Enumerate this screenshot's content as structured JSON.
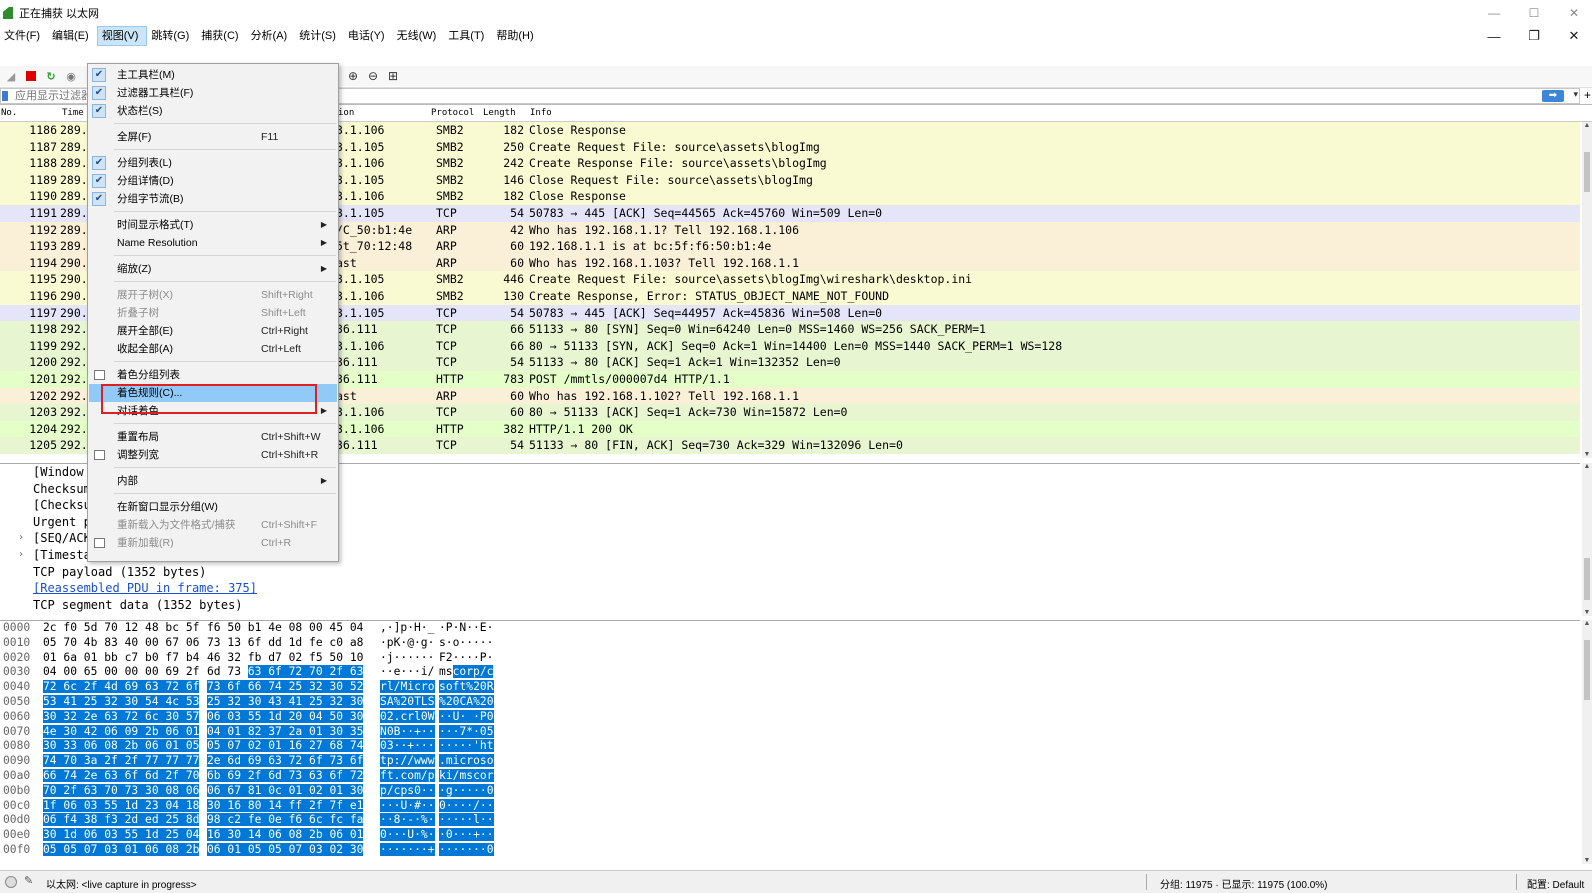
{
  "window": {
    "title": "正在捕获 以太网"
  },
  "menubar": [
    "文件(F)",
    "编辑(E)",
    "视图(V)",
    "跳转(G)",
    "捕获(C)",
    "分析(A)",
    "统计(S)",
    "电话(Y)",
    "无线(W)",
    "工具(T)",
    "帮助(H)"
  ],
  "filter": {
    "placeholder": "应用显示过滤器…"
  },
  "columns": {
    "no": "No.",
    "time": "Time",
    "dest": "ion",
    "protocol": "Protocol",
    "length": "Length",
    "info": "Info"
  },
  "colors": {
    "smb2": "#fafad2",
    "tcp_ack": "#e5e5f9",
    "arp": "#faf0d7",
    "tcp": "#e7f6d1",
    "http": "#e4ffc7",
    "selection": "#0078d7"
  },
  "packets": [
    {
      "no": "1186",
      "time": "289.",
      "dest": "3.1.106",
      "proto": "SMB2",
      "len": "182",
      "info": "Close Response",
      "color": "smb2"
    },
    {
      "no": "1187",
      "time": "289.",
      "dest": "3.1.105",
      "proto": "SMB2",
      "len": "250",
      "info": "Create Request File: source\\assets\\blogImg",
      "color": "smb2"
    },
    {
      "no": "1188",
      "time": "289.",
      "dest": "3.1.106",
      "proto": "SMB2",
      "len": "242",
      "info": "Create Response File: source\\assets\\blogImg",
      "color": "smb2"
    },
    {
      "no": "1189",
      "time": "289.",
      "dest": "3.1.105",
      "proto": "SMB2",
      "len": "146",
      "info": "Close Request File: source\\assets\\blogImg",
      "color": "smb2"
    },
    {
      "no": "1190",
      "time": "289.",
      "dest": "3.1.106",
      "proto": "SMB2",
      "len": "182",
      "info": "Close Response",
      "color": "smb2"
    },
    {
      "no": "1191",
      "time": "289.",
      "dest": "3.1.105",
      "proto": "TCP",
      "len": "54",
      "info": "50783 → 445 [ACK] Seq=44565 Ack=45760 Win=509 Len=0",
      "color": "tcp_ack"
    },
    {
      "no": "1192",
      "time": "289.",
      "dest": "/C_50:b1:4e",
      "proto": "ARP",
      "len": "42",
      "info": "Who has 192.168.1.1? Tell 192.168.1.106",
      "color": "arp"
    },
    {
      "no": "1193",
      "time": "289.",
      "dest": "5t_70:12:48",
      "proto": "ARP",
      "len": "60",
      "info": "192.168.1.1 is at bc:5f:f6:50:b1:4e",
      "color": "arp"
    },
    {
      "no": "1194",
      "time": "290.",
      "dest": "ast",
      "proto": "ARP",
      "len": "60",
      "info": "Who has 192.168.1.103? Tell 192.168.1.1",
      "color": "arp"
    },
    {
      "no": "1195",
      "time": "290.",
      "dest": "3.1.105",
      "proto": "SMB2",
      "len": "446",
      "info": "Create Request File: source\\assets\\blogImg\\wireshark\\desktop.ini",
      "color": "smb2"
    },
    {
      "no": "1196",
      "time": "290.",
      "dest": "3.1.106",
      "proto": "SMB2",
      "len": "130",
      "info": "Create Response, Error: STATUS_OBJECT_NAME_NOT_FOUND",
      "color": "smb2"
    },
    {
      "no": "1197",
      "time": "290.",
      "dest": "3.1.105",
      "proto": "TCP",
      "len": "54",
      "info": "50783 → 445 [ACK] Seq=44957 Ack=45836 Win=508 Len=0",
      "color": "tcp_ack"
    },
    {
      "no": "1198",
      "time": "292.",
      "dest": "36.111",
      "proto": "TCP",
      "len": "66",
      "info": "51133 → 80 [SYN] Seq=0 Win=64240 Len=0 MSS=1460 WS=256 SACK_PERM=1",
      "color": "tcp"
    },
    {
      "no": "1199",
      "time": "292.",
      "dest": "3.1.106",
      "proto": "TCP",
      "len": "66",
      "info": "80 → 51133 [SYN, ACK] Seq=0 Ack=1 Win=14400 Len=0 MSS=1440 SACK_PERM=1 WS=128",
      "color": "tcp"
    },
    {
      "no": "1200",
      "time": "292.",
      "dest": "36.111",
      "proto": "TCP",
      "len": "54",
      "info": "51133 → 80 [ACK] Seq=1 Ack=1 Win=132352 Len=0",
      "color": "tcp"
    },
    {
      "no": "1201",
      "time": "292.",
      "dest": "36.111",
      "proto": "HTTP",
      "len": "783",
      "info": "POST /mmtls/000007d4 HTTP/1.1",
      "color": "http"
    },
    {
      "no": "1202",
      "time": "292.",
      "dest": "ast",
      "proto": "ARP",
      "len": "60",
      "info": "Who has 192.168.1.102? Tell 192.168.1.1",
      "color": "arp"
    },
    {
      "no": "1203",
      "time": "292.",
      "dest": "3.1.106",
      "proto": "TCP",
      "len": "60",
      "info": "80 → 51133 [ACK] Seq=1 Ack=730 Win=15872 Len=0",
      "color": "tcp"
    },
    {
      "no": "1204",
      "time": "292.",
      "dest": "3.1.106",
      "proto": "HTTP",
      "len": "382",
      "info": "HTTP/1.1 200 OK",
      "color": "http"
    },
    {
      "no": "1205",
      "time": "292.",
      "dest": "36.111",
      "proto": "TCP",
      "len": "54",
      "info": "51133 → 80 [FIN, ACK] Seq=730 Ack=329 Win=132096 Len=0",
      "color": "tcp"
    }
  ],
  "details": [
    {
      "text": "[Window",
      "expander": "",
      "link": false
    },
    {
      "text": "Checksum",
      "expander": "",
      "link": false
    },
    {
      "text": "[Checksu",
      "expander": "",
      "link": false
    },
    {
      "text": "Urgent p",
      "expander": "",
      "link": false
    },
    {
      "text": "[SEQ/ACK",
      "expander": "›",
      "link": false
    },
    {
      "text": "[Timesta",
      "expander": "›",
      "link": false
    },
    {
      "text": "TCP payload (1352 bytes)",
      "expander": "",
      "link": false
    },
    {
      "text": "[Reassembled PDU in frame: 375]",
      "expander": "",
      "link": true
    },
    {
      "text": "TCP segment data (1352 bytes)",
      "expander": "",
      "link": false
    }
  ],
  "bytes": [
    {
      "off": "0000",
      "h1": "2c f0 5d 70 12 48 bc 5f",
      "h2": "f6 50 b1 4e 08 00 45 04",
      "a1": ",·]p·H·_",
      "a2": "·P·N··E·",
      "sel": 0
    },
    {
      "off": "0010",
      "h1": "05 70 4b 83 40 00 67 06",
      "h2": "73 13 6f dd 1d fe c0 a8",
      "a1": "·pK·@·g·",
      "a2": "s·o·····",
      "sel": 0
    },
    {
      "off": "0020",
      "h1": "01 6a 01 bb c7 b0 f7 b4",
      "h2": "46 32 fb d7 02 f5 50 10",
      "a1": "·j······",
      "a2": "F2····P·",
      "sel": 0
    },
    {
      "off": "0030",
      "h1": "04 00 65 00 00 00 69 2f",
      "h2": "6d 73 63 6f 72 70 2f 63",
      "a1": "··e···i/",
      "a2": "mscorp/c",
      "sel": 6
    },
    {
      "off": "0040",
      "h1": "72 6c 2f 4d 69 63 72 6f",
      "h2": "73 6f 66 74 25 32 30 52",
      "a1": "rl/Micro",
      "a2": "soft%20R",
      "sel": 16
    },
    {
      "off": "0050",
      "h1": "53 41 25 32 30 54 4c 53",
      "h2": "25 32 30 43 41 25 32 30",
      "a1": "SA%20TLS",
      "a2": "%20CA%20",
      "sel": 16
    },
    {
      "off": "0060",
      "h1": "30 32 2e 63 72 6c 30 57",
      "h2": "06 03 55 1d 20 04 50 30",
      "a1": "02.crl0W",
      "a2": "··U· ·P0",
      "sel": 16
    },
    {
      "off": "0070",
      "h1": "4e 30 42 06 09 2b 06 01",
      "h2": "04 01 82 37 2a 01 30 35",
      "a1": "N0B··+··",
      "a2": "···7*·05",
      "sel": 16
    },
    {
      "off": "0080",
      "h1": "30 33 06 08 2b 06 01 05",
      "h2": "05 07 02 01 16 27 68 74",
      "a1": "03··+···",
      "a2": "·····'ht",
      "sel": 16
    },
    {
      "off": "0090",
      "h1": "74 70 3a 2f 2f 77 77 77",
      "h2": "2e 6d 69 63 72 6f 73 6f",
      "a1": "tp://www",
      "a2": ".microso",
      "sel": 16
    },
    {
      "off": "00a0",
      "h1": "66 74 2e 63 6f 6d 2f 70",
      "h2": "6b 69 2f 6d 73 63 6f 72",
      "a1": "ft.com/p",
      "a2": "ki/mscor",
      "sel": 16
    },
    {
      "off": "00b0",
      "h1": "70 2f 63 70 73 30 08 06",
      "h2": "06 67 81 0c 01 02 01 30",
      "a1": "p/cps0··",
      "a2": "·g·····0",
      "sel": 16
    },
    {
      "off": "00c0",
      "h1": "1f 06 03 55 1d 23 04 18",
      "h2": "30 16 80 14 ff 2f 7f e1",
      "a1": "···U·#··",
      "a2": "0····/··",
      "sel": 16
    },
    {
      "off": "00d0",
      "h1": "06 f4 38 f3 2d ed 25 8d",
      "h2": "98 c2 fe 0e f6 6c fc fa",
      "a1": "··8·-·%·",
      "a2": "·····l··",
      "sel": 16
    },
    {
      "off": "00e0",
      "h1": "30 1d 06 03 55 1d 25 04",
      "h2": "16 30 14 06 08 2b 06 01",
      "a1": "0···U·%·",
      "a2": "·0···+··",
      "sel": 16
    },
    {
      "off": "00f0",
      "h1": "05 05 07 03 01 06 08 2b",
      "h2": "06 01 05 05 07 03 02 30",
      "a1": "·······+",
      "a2": "·······0",
      "sel": 16
    }
  ],
  "view_menu": [
    {
      "type": "item",
      "label": "主工具栏(M)",
      "shortcut": "",
      "checked": true,
      "disabled": false,
      "sub": false
    },
    {
      "type": "item",
      "label": "过滤器工具栏(F)",
      "shortcut": "",
      "checked": true,
      "disabled": false,
      "sub": false
    },
    {
      "type": "item",
      "label": "状态栏(S)",
      "shortcut": "",
      "checked": true,
      "disabled": false,
      "sub": false
    },
    {
      "type": "sep"
    },
    {
      "type": "item",
      "label": "全屏(F)",
      "shortcut": "F11",
      "checked": false,
      "disabled": false,
      "sub": false
    },
    {
      "type": "sep"
    },
    {
      "type": "item",
      "label": "分组列表(L)",
      "shortcut": "",
      "checked": true,
      "disabled": false,
      "sub": false
    },
    {
      "type": "item",
      "label": "分组详情(D)",
      "shortcut": "",
      "checked": true,
      "disabled": false,
      "sub": false
    },
    {
      "type": "item",
      "label": "分组字节流(B)",
      "shortcut": "",
      "checked": true,
      "disabled": false,
      "sub": false
    },
    {
      "type": "sep"
    },
    {
      "type": "item",
      "label": "时间显示格式(T)",
      "shortcut": "",
      "checked": false,
      "disabled": false,
      "sub": true
    },
    {
      "type": "item",
      "label": "Name Resolution",
      "shortcut": "",
      "checked": false,
      "disabled": false,
      "sub": true
    },
    {
      "type": "sep"
    },
    {
      "type": "item",
      "label": "缩放(Z)",
      "shortcut": "",
      "checked": false,
      "disabled": false,
      "sub": true
    },
    {
      "type": "sep"
    },
    {
      "type": "item",
      "label": "展开子树(X)",
      "shortcut": "Shift+Right",
      "checked": false,
      "disabled": true,
      "sub": false
    },
    {
      "type": "item",
      "label": "折叠子树",
      "shortcut": "Shift+Left",
      "checked": false,
      "disabled": true,
      "sub": false
    },
    {
      "type": "item",
      "label": "展开全部(E)",
      "shortcut": "Ctrl+Right",
      "checked": false,
      "disabled": false,
      "sub": false
    },
    {
      "type": "item",
      "label": "收起全部(A)",
      "shortcut": "Ctrl+Left",
      "checked": false,
      "disabled": false,
      "sub": false
    },
    {
      "type": "sep"
    },
    {
      "type": "item",
      "label": "着色分组列表",
      "shortcut": "",
      "checked": false,
      "disabled": false,
      "sub": false,
      "icon": true
    },
    {
      "type": "item",
      "label": "着色规则(C)...",
      "shortcut": "",
      "checked": false,
      "disabled": false,
      "sub": false,
      "hover": true
    },
    {
      "type": "item",
      "label": "对话着色",
      "shortcut": "",
      "checked": false,
      "disabled": false,
      "sub": true
    },
    {
      "type": "sep"
    },
    {
      "type": "item",
      "label": "重置布局",
      "shortcut": "Ctrl+Shift+W",
      "checked": false,
      "disabled": false,
      "sub": false
    },
    {
      "type": "item",
      "label": "调整列宽",
      "shortcut": "Ctrl+Shift+R",
      "checked": false,
      "disabled": false,
      "sub": false,
      "icon": true
    },
    {
      "type": "sep"
    },
    {
      "type": "item",
      "label": "内部",
      "shortcut": "",
      "checked": false,
      "disabled": false,
      "sub": true
    },
    {
      "type": "sep"
    },
    {
      "type": "item",
      "label": "在新窗口显示分组(W)",
      "shortcut": "",
      "checked": false,
      "disabled": false,
      "sub": false
    },
    {
      "type": "item",
      "label": "重新载入为文件格式/捕获",
      "shortcut": "Ctrl+Shift+F",
      "checked": false,
      "disabled": true,
      "sub": false
    },
    {
      "type": "item",
      "label": "重新加载(R)",
      "shortcut": "Ctrl+R",
      "checked": false,
      "disabled": true,
      "sub": false,
      "icon": true
    }
  ],
  "status": {
    "interface": "以太网: <live capture in progress>",
    "packets": "分组: 11975 · 已显示: 11975 (100.0%)",
    "profile": "配置: Default"
  }
}
